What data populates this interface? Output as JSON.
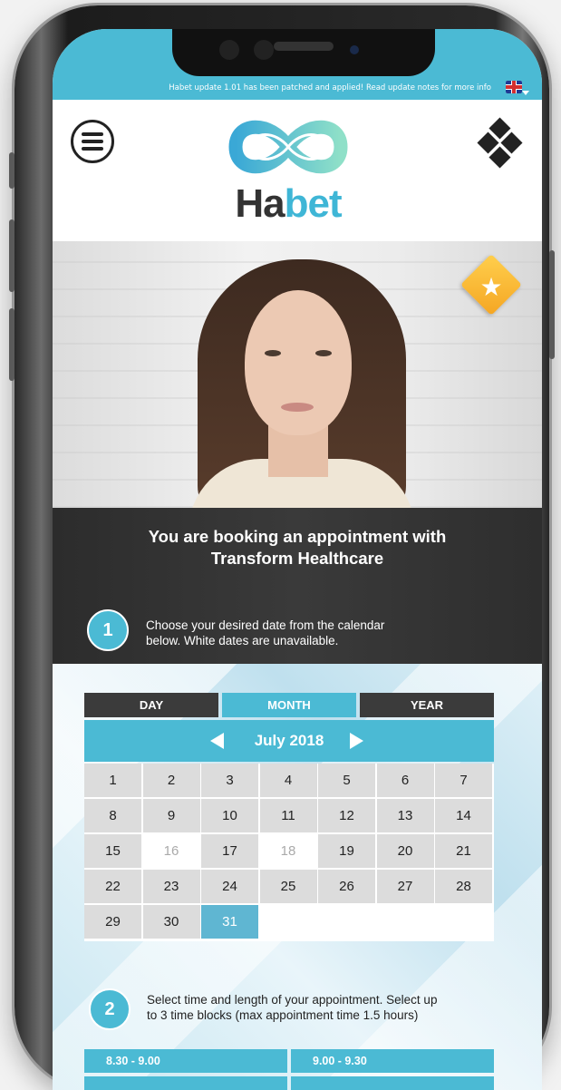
{
  "announcement": "Habet update 1.01 has been patched and applied! Read update notes for more info",
  "language_icon": "uk-flag-icon",
  "header": {
    "menu_icon": "hamburger-menu-icon",
    "grid_icon": "diamond-grid-icon",
    "logo_part1": "Ha",
    "logo_part2": "bet"
  },
  "profile": {
    "favorite_icon": "star-icon",
    "star_glyph": "★"
  },
  "booking": {
    "title_line1": "You are booking an appointment with",
    "title_line2": "Transform Healthcare",
    "step1_number": "1",
    "step1_text_line1": "Choose your desired date from the calendar",
    "step1_text_line2": "below. White dates are unavailable.",
    "step2_number": "2",
    "step2_text_line1": "Select time and length of your appointment. Select up",
    "step2_text_line2": "to 3 time blocks (max appointment time 1.5 hours)"
  },
  "calendar": {
    "tabs": [
      "DAY",
      "MONTH",
      "YEAR"
    ],
    "active_tab": "MONTH",
    "month_label": "July 2018",
    "days": [
      "1",
      "2",
      "3",
      "4",
      "5",
      "6",
      "7",
      "8",
      "9",
      "10",
      "11",
      "12",
      "13",
      "14",
      "15",
      "16",
      "17",
      "18",
      "19",
      "20",
      "21",
      "22",
      "23",
      "24",
      "25",
      "26",
      "27",
      "28",
      "29",
      "30",
      "31"
    ],
    "unavailable": [
      "16",
      "18"
    ],
    "selected": "31"
  },
  "time_slots": [
    "8.30 - 9.00",
    "9.00 - 9.30"
  ],
  "colors": {
    "accent": "#4bbad4",
    "dark": "#3b3b3b",
    "star_badge": "#f5a623"
  }
}
